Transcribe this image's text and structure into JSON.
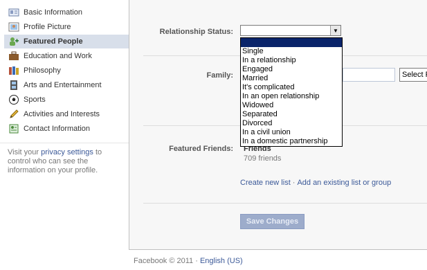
{
  "sidebar": {
    "items": [
      {
        "label": "Basic Information",
        "icon": "profile-card-icon"
      },
      {
        "label": "Profile Picture",
        "icon": "picture-icon"
      },
      {
        "label": "Featured People",
        "icon": "people-add-icon",
        "active": true
      },
      {
        "label": "Education and Work",
        "icon": "briefcase-icon"
      },
      {
        "label": "Philosophy",
        "icon": "books-icon"
      },
      {
        "label": "Arts and Entertainment",
        "icon": "film-icon"
      },
      {
        "label": "Sports",
        "icon": "soccer-ball-icon"
      },
      {
        "label": "Activities and Interests",
        "icon": "pencil-icon"
      },
      {
        "label": "Contact Information",
        "icon": "contact-card-icon"
      }
    ],
    "privacy_prefix": "Visit your ",
    "privacy_link": "privacy settings",
    "privacy_suffix": " to control who can see the information on your profile."
  },
  "form": {
    "relationship_label": "Relationship Status:",
    "relationship_value": "",
    "relationship_options": [
      "",
      "Single",
      "In a relationship",
      "Engaged",
      "Married",
      "It's complicated",
      "In an open relationship",
      "Widowed",
      "Separated",
      "Divorced",
      "In a civil union",
      "In a domestic partnership"
    ],
    "family_label": "Family:",
    "family_select": "Select F",
    "featured_friends_label": "Featured Friends:",
    "friends_title": "Friends",
    "friends_count": "709 friends",
    "create_list": "Create new list",
    "link_sep": "·",
    "add_list": "Add an existing list or group",
    "save_button": "Save Changes"
  },
  "footer": {
    "copyright": "Facebook © 2011 · ",
    "language": "English (US)"
  },
  "colors": {
    "link": "#3b5998",
    "selection": "#0a246a",
    "active_nav": "#d8dfea"
  }
}
